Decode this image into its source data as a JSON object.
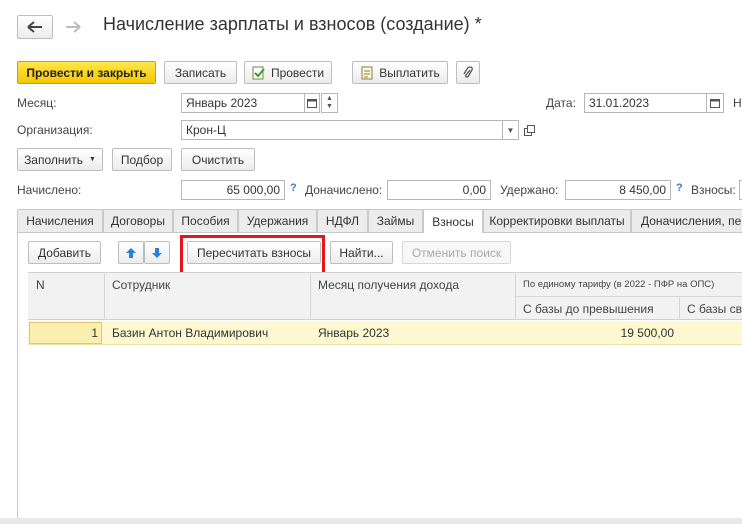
{
  "window": {
    "title": "Начисление зарплаты и взносов (создание) *",
    "star_icon": "star-icon"
  },
  "toolbar": {
    "post_close": "Провести и закрыть",
    "save": "Записать",
    "post": "Провести",
    "pay": "Выплатить"
  },
  "form": {
    "month_label": "Месяц:",
    "month_value": "Январь 2023",
    "date_label": "Дата:",
    "date_value": "31.01.2023",
    "number_label_cut": "Н",
    "org_label": "Организация:",
    "org_value": "Крон-Ц"
  },
  "actions": {
    "fill": "Заполнить",
    "select": "Подбор",
    "clear": "Очистить"
  },
  "totals": {
    "accrued_label": "Начислено:",
    "accrued_value": "65 000,00",
    "extra_label": "Доначислено:",
    "extra_value": "0,00",
    "withheld_label": "Удержано:",
    "withheld_value": "8 450,00",
    "contrib_label": "Взносы:",
    "help": "?"
  },
  "tabs": [
    "Начисления",
    "Договоры",
    "Пособия",
    "Удержания",
    "НДФЛ",
    "Займы",
    "Взносы",
    "Корректировки выплаты",
    "Доначисления, пер"
  ],
  "active_tab": "Взносы",
  "tab_toolbar": {
    "add": "Добавить",
    "recalc": "Пересчитать взносы",
    "find": "Найти...",
    "cancel_search": "Отменить поиск"
  },
  "table": {
    "columns": {
      "n": "N",
      "employee": "Сотрудник",
      "month": "Месяц получения дохода",
      "group": "По единому тарифу (в 2022 - ПФР на ОПС)",
      "base_before": "С базы до превышения",
      "base_over": "С базы св"
    },
    "rows": [
      {
        "n": "1",
        "employee": "Базин Антон Владимирович",
        "month": "Январь 2023",
        "base_before": "19 500,00",
        "base_over": ""
      }
    ]
  },
  "colors": {
    "highlight": "#e8141c",
    "primary": "#f5c800",
    "row_selected": "#fdf7d2"
  }
}
